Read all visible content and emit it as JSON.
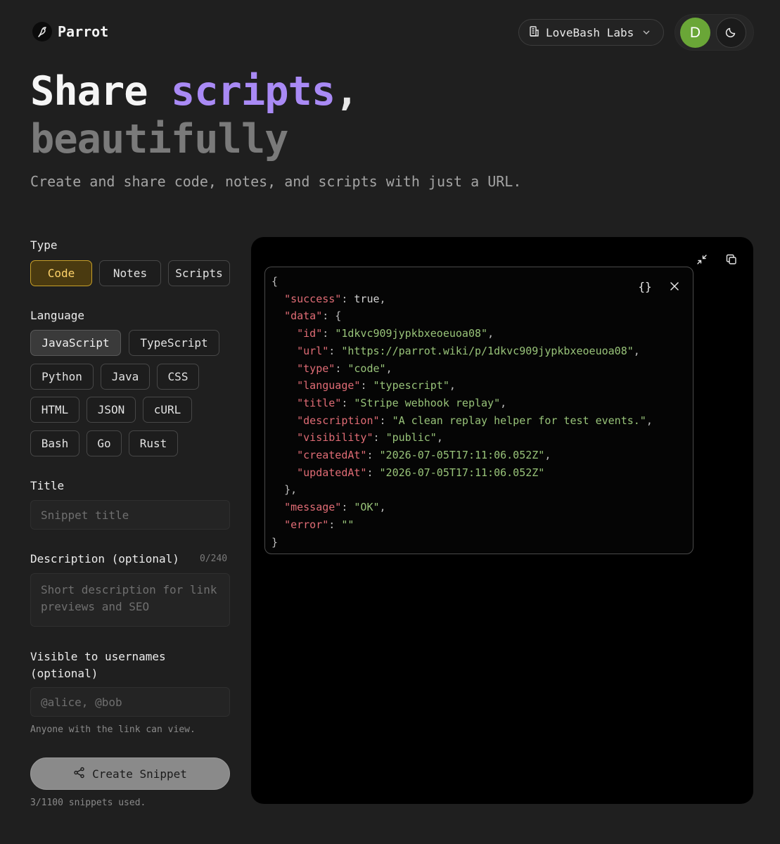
{
  "header": {
    "brand_name": "Parrot",
    "org_name": "LoveBash Labs",
    "avatar_initial": "D"
  },
  "hero": {
    "title_word1": "Share",
    "title_word2": "scripts",
    "title_comma": ",",
    "title_line2": "beautifully",
    "subtitle": "Create and share code, notes, and scripts with just a URL."
  },
  "form": {
    "type_label": "Type",
    "types": [
      "Code",
      "Notes",
      "Scripts"
    ],
    "selected_type": "Code",
    "language_label": "Language",
    "languages": [
      "JavaScript",
      "TypeScript",
      "Python",
      "Java",
      "CSS",
      "HTML",
      "JSON",
      "cURL",
      "Bash",
      "Go",
      "Rust"
    ],
    "selected_language": "JavaScript",
    "title_label": "Title",
    "title_placeholder": "Snippet title",
    "description_label": "Description (optional)",
    "description_counter": "0/240",
    "description_placeholder": "Short description for link previews and SEO",
    "visible_label": "Visible to usernames (optional)",
    "visible_placeholder": "@alice, @bob",
    "visible_hint": "Anyone with the link can view.",
    "create_button": "Create Snippet",
    "usage": "3/1100 snippets used."
  },
  "editor": {
    "format_label": "{}",
    "json": {
      "success": "true",
      "id": "\"1dkvc909jypkbxeoeuoa08\"",
      "url": "\"https://parrot.wiki/p/1dkvc909jypkbxeoeuoa08\"",
      "type": "\"code\"",
      "language": "\"typescript\"",
      "title": "\"Stripe webhook replay\"",
      "description": "\"A clean replay helper for test events.\"",
      "visibility": "\"public\"",
      "createdAt": "\"2026-07-05T17:11:06.052Z\"",
      "updatedAt": "\"2026-07-05T17:11:06.052Z\"",
      "message": "\"OK\"",
      "error": "\"\""
    }
  },
  "colors": {
    "accent_purple": "#a98af5",
    "selected_type_bg": "#4a3a10",
    "selected_type_border": "#c8a028",
    "avatar_green": "#6aa637",
    "json_key": "#e06c75",
    "json_string": "#98c379"
  },
  "icons": [
    "parrot-logo-icon",
    "building-icon",
    "chevron-down-icon",
    "moon-icon",
    "collapse-icon",
    "copy-icon",
    "close-icon",
    "share-icon"
  ]
}
